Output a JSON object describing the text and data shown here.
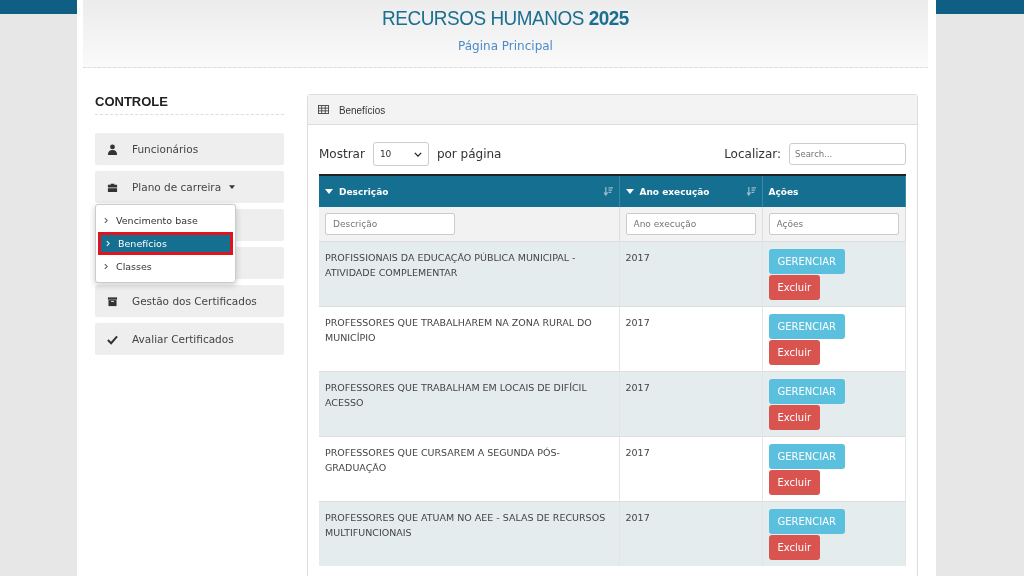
{
  "header": {
    "title": "RECURSOS HUMANOS",
    "year": "2025",
    "breadcrumb": "Página Principal"
  },
  "sidebar": {
    "heading": "CONTROLE",
    "items": [
      {
        "kind": "link",
        "label": "Funcionários"
      },
      {
        "kind": "dropdown",
        "label": "Plano de carreira",
        "expanded": true,
        "menu": [
          {
            "label": "Vencimento base",
            "selected": false
          },
          {
            "label": "Benefícios",
            "selected": true
          },
          {
            "label": "Classes",
            "selected": false
          }
        ]
      },
      {
        "kind": "hidden"
      },
      {
        "kind": "hidden"
      },
      {
        "kind": "link",
        "label": "Gestão dos Certificados"
      },
      {
        "kind": "link",
        "label": "Avaliar Certificados"
      }
    ]
  },
  "panel": {
    "title": "Benefícios",
    "show_label": "Mostrar",
    "page_size": "10",
    "per_page_label": "por página",
    "search_label": "Localizar:",
    "search_placeholder": "Search...",
    "columns": [
      {
        "label": "Descrição",
        "sortable": true,
        "filter_placeholder": "Descrição"
      },
      {
        "label": "Ano execução",
        "sortable": true,
        "filter_placeholder": "Ano execução"
      },
      {
        "label": "Ações",
        "sortable": false,
        "filter_placeholder": "Ações"
      }
    ],
    "rows": [
      {
        "description": "PROFISSIONAIS DA EDUCAÇÃO PÚBLICA MUNICIPAL - ATIVIDADE COMPLEMENTAR",
        "year": "2017",
        "actions": [
          "GERENCIAR",
          "Excluir"
        ]
      },
      {
        "description": "PROFESSORES QUE TRABALHAREM NA ZONA RURAL DO MUNICÍPIO",
        "year": "2017",
        "actions": [
          "GERENCIAR",
          "Excluir"
        ]
      },
      {
        "description": "PROFESSORES QUE TRABALHAM EM LOCAIS DE DIFÍCIL ACESSO",
        "year": "2017",
        "actions": [
          "GERENCIAR",
          "Excluir"
        ]
      },
      {
        "description": "PROFESSORES QUE CURSAREM A SEGUNDA PÓS-GRADUAÇÃO",
        "year": "2017",
        "actions": [
          "GERENCIAR",
          "Excluir"
        ]
      },
      {
        "description": "PROFESSORES QUE ATUAM NO AEE - SALAS DE RECURSOS MULTIFUNCIONAIS",
        "year": "2017",
        "actions": [
          "GERENCIAR",
          "Excluir"
        ]
      }
    ]
  }
}
